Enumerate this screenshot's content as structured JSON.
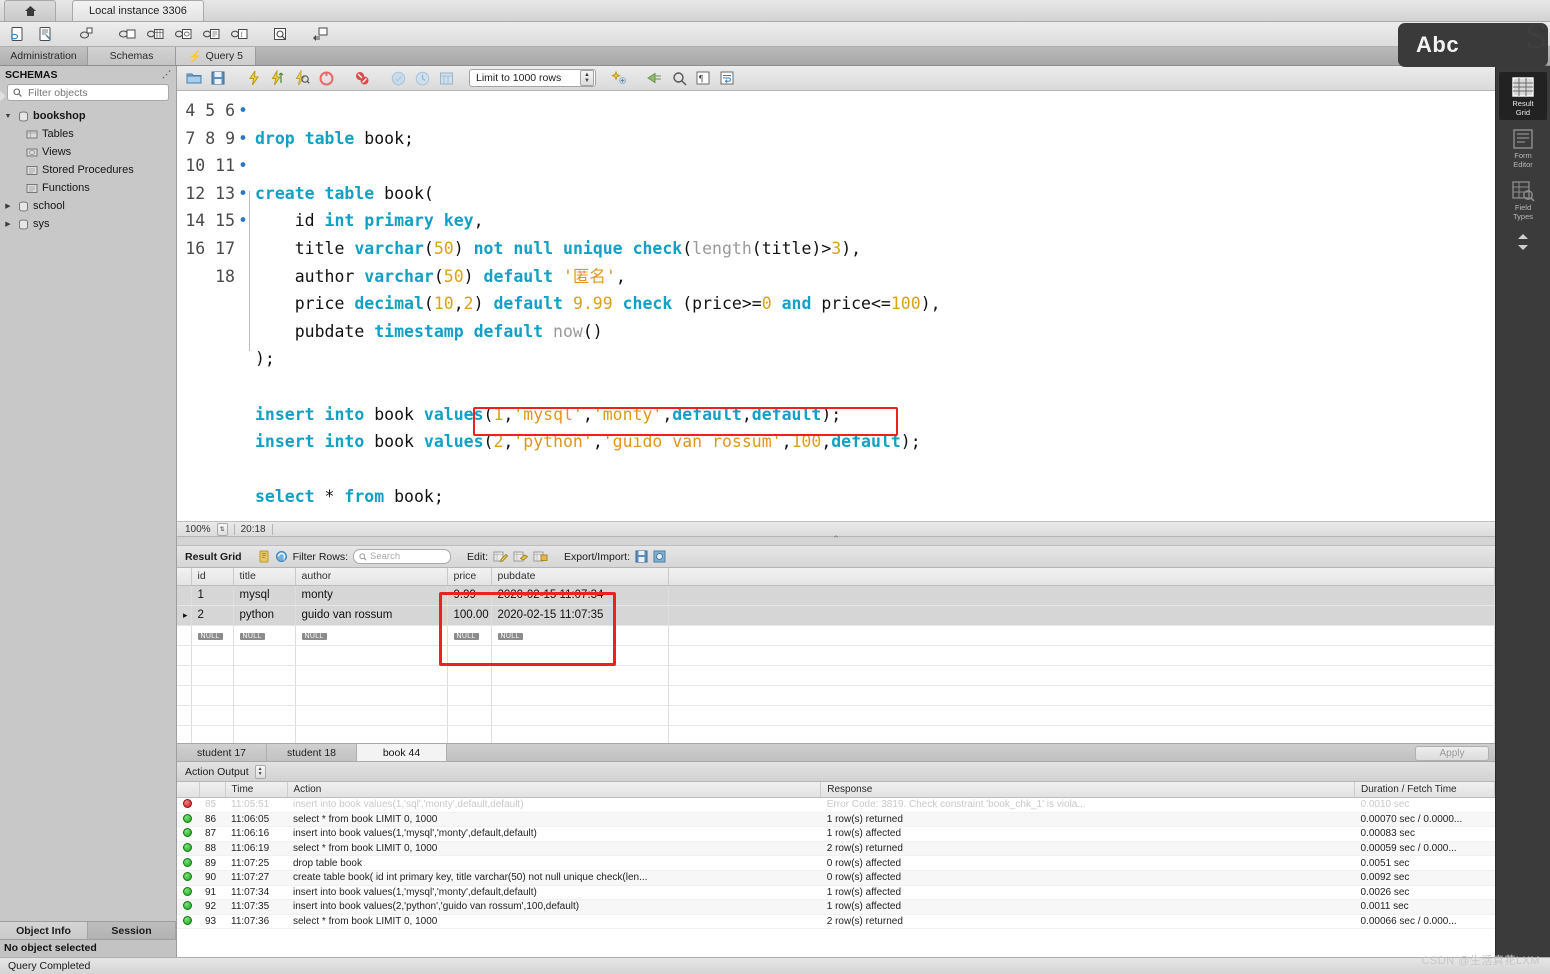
{
  "window": {
    "home_tab_icon": "home-icon",
    "instance_tab": "Local instance 3306"
  },
  "main_toolbar": {
    "buttons": [
      {
        "name": "new-sql-tab-icon",
        "tip": "New SQL Tab"
      },
      {
        "name": "open-sql-script-icon",
        "tip": "Open SQL Script"
      },
      {
        "name": "new-connection-icon",
        "tip": "New Connection"
      },
      {
        "name": "new-schema-icon",
        "tip": "Create New Schema"
      },
      {
        "name": "new-table-icon",
        "tip": "Create New Table"
      },
      {
        "name": "new-view-icon",
        "tip": "Create New View"
      },
      {
        "name": "new-procedure-icon",
        "tip": "Create New Procedure"
      },
      {
        "name": "new-function-icon",
        "tip": "Create New Function"
      },
      {
        "name": "search-table-data-icon",
        "tip": "Search Table Data"
      },
      {
        "name": "reconnect-dbms-icon",
        "tip": "Reconnect to DBMS"
      }
    ]
  },
  "nav_tabs": [
    {
      "label": "Administration",
      "active": false
    },
    {
      "label": "Schemas",
      "active": true
    },
    {
      "label": "Query 5",
      "active": true,
      "icon": "lightning-icon"
    }
  ],
  "sidebar": {
    "header": "SCHEMAS",
    "collapse_icon": "collapse-icon",
    "search_placeholder": "Filter objects",
    "search_value": "",
    "search_icon": "search-icon",
    "tree": [
      {
        "label": "bookshop",
        "level": 1,
        "expanded": true,
        "bold": true
      },
      {
        "label": "Tables",
        "level": 2
      },
      {
        "label": "Views",
        "level": 2
      },
      {
        "label": "Stored Procedures",
        "level": 2
      },
      {
        "label": "Functions",
        "level": 2
      },
      {
        "label": "school",
        "level": 1,
        "expanded": false
      },
      {
        "label": "sys",
        "level": 1,
        "expanded": false
      }
    ],
    "bottom_tabs": [
      {
        "label": "Object Info",
        "active": true
      },
      {
        "label": "Session",
        "active": false
      }
    ],
    "bottom_note": "No object selected"
  },
  "query_toolbar": {
    "buttons": [
      {
        "name": "open-script-icon"
      },
      {
        "name": "save-script-icon"
      },
      {
        "name": "execute-statement-icon"
      },
      {
        "name": "execute-current-statement-icon"
      },
      {
        "name": "explain-statement-icon"
      },
      {
        "name": "stop-execution-icon"
      },
      {
        "name": "toggle-stop-on-error-icon"
      },
      {
        "name": "commit-icon"
      },
      {
        "name": "rollback-icon"
      },
      {
        "name": "autocommit-icon"
      },
      {
        "name": "beautify-query-icon"
      },
      {
        "name": "find-icon"
      },
      {
        "name": "toggle-invisible-chars-icon"
      },
      {
        "name": "wrap-lines-icon"
      }
    ],
    "limit_label": "Limit to 1000 rows",
    "limit_dropdown_icon": "stepper-icon"
  },
  "editor": {
    "zoom": "100%",
    "cursor_pos": "20:18",
    "lines": [
      {
        "n": "4",
        "marker": "",
        "tokens": []
      },
      {
        "n": "5",
        "marker": "•",
        "tokens": [
          {
            "t": "drop",
            "c": "k"
          },
          {
            "t": " ",
            "c": "pl"
          },
          {
            "t": "table",
            "c": "k"
          },
          {
            "t": " book;",
            "c": "pl"
          }
        ]
      },
      {
        "n": "6",
        "marker": "",
        "tokens": []
      },
      {
        "n": "7",
        "marker": "•",
        "fold": true,
        "tokens": [
          {
            "t": "create",
            "c": "k"
          },
          {
            "t": " ",
            "c": "pl"
          },
          {
            "t": "table",
            "c": "k"
          },
          {
            "t": " book(",
            "c": "pl"
          }
        ]
      },
      {
        "n": "8",
        "marker": "",
        "tokens": [
          {
            "t": "    id ",
            "c": "pl"
          },
          {
            "t": "int",
            "c": "k"
          },
          {
            "t": " ",
            "c": "pl"
          },
          {
            "t": "primary",
            "c": "k"
          },
          {
            "t": " ",
            "c": "pl"
          },
          {
            "t": "key",
            "c": "k"
          },
          {
            "t": ",",
            "c": "pl"
          }
        ]
      },
      {
        "n": "9",
        "marker": "",
        "tokens": [
          {
            "t": "    title ",
            "c": "pl"
          },
          {
            "t": "varchar",
            "c": "k"
          },
          {
            "t": "(",
            "c": "pl"
          },
          {
            "t": "50",
            "c": "num"
          },
          {
            "t": ") ",
            "c": "pl"
          },
          {
            "t": "not",
            "c": "k"
          },
          {
            "t": " ",
            "c": "pl"
          },
          {
            "t": "null",
            "c": "k"
          },
          {
            "t": " ",
            "c": "pl"
          },
          {
            "t": "unique",
            "c": "k"
          },
          {
            "t": " ",
            "c": "pl"
          },
          {
            "t": "check",
            "c": "k"
          },
          {
            "t": "(",
            "c": "pl"
          },
          {
            "t": "length",
            "c": "fn"
          },
          {
            "t": "(title)>",
            "c": "pl"
          },
          {
            "t": "3",
            "c": "num"
          },
          {
            "t": "),",
            "c": "pl"
          }
        ]
      },
      {
        "n": "10",
        "marker": "",
        "tokens": [
          {
            "t": "    author ",
            "c": "pl"
          },
          {
            "t": "varchar",
            "c": "k"
          },
          {
            "t": "(",
            "c": "pl"
          },
          {
            "t": "50",
            "c": "num"
          },
          {
            "t": ") ",
            "c": "pl"
          },
          {
            "t": "default",
            "c": "k"
          },
          {
            "t": " ",
            "c": "pl"
          },
          {
            "t": "'匿名'",
            "c": "str"
          },
          {
            "t": ",",
            "c": "pl"
          }
        ]
      },
      {
        "n": "11",
        "marker": "",
        "tokens": [
          {
            "t": "    price ",
            "c": "pl"
          },
          {
            "t": "decimal",
            "c": "k"
          },
          {
            "t": "(",
            "c": "pl"
          },
          {
            "t": "10",
            "c": "num"
          },
          {
            "t": ",",
            "c": "pl"
          },
          {
            "t": "2",
            "c": "num"
          },
          {
            "t": ") ",
            "c": "pl"
          },
          {
            "t": "default",
            "c": "k"
          },
          {
            "t": " ",
            "c": "pl"
          },
          {
            "t": "9.99",
            "c": "num"
          },
          {
            "t": " ",
            "c": "pl"
          },
          {
            "t": "check",
            "c": "k"
          },
          {
            "t": " (price>=",
            "c": "pl"
          },
          {
            "t": "0",
            "c": "num"
          },
          {
            "t": " ",
            "c": "pl"
          },
          {
            "t": "and",
            "c": "k"
          },
          {
            "t": " price<=",
            "c": "pl"
          },
          {
            "t": "100",
            "c": "num"
          },
          {
            "t": "),",
            "c": "pl"
          }
        ]
      },
      {
        "n": "12",
        "marker": "",
        "tokens": [
          {
            "t": "    pubdate ",
            "c": "pl"
          },
          {
            "t": "timestamp",
            "c": "k"
          },
          {
            "t": " ",
            "c": "pl"
          },
          {
            "t": "default",
            "c": "k"
          },
          {
            "t": " ",
            "c": "pl"
          },
          {
            "t": "now",
            "c": "fn"
          },
          {
            "t": "()",
            "c": "pl"
          }
        ]
      },
      {
        "n": "13",
        "marker": "",
        "tokens": [
          {
            "t": ");",
            "c": "pl"
          }
        ]
      },
      {
        "n": "14",
        "marker": "",
        "tokens": []
      },
      {
        "n": "15",
        "marker": "•",
        "tokens": [
          {
            "t": "insert",
            "c": "k"
          },
          {
            "t": " ",
            "c": "pl"
          },
          {
            "t": "into",
            "c": "k"
          },
          {
            "t": " book ",
            "c": "pl"
          },
          {
            "t": "values",
            "c": "k"
          },
          {
            "t": "(",
            "c": "pl"
          },
          {
            "t": "1",
            "c": "num"
          },
          {
            "t": ",",
            "c": "pl"
          },
          {
            "t": "'mysql'",
            "c": "str"
          },
          {
            "t": ",",
            "c": "pl"
          },
          {
            "t": "'monty'",
            "c": "str"
          },
          {
            "t": ",",
            "c": "pl"
          },
          {
            "t": "default",
            "c": "k"
          },
          {
            "t": ",",
            "c": "pl"
          },
          {
            "t": "default",
            "c": "k"
          },
          {
            "t": ");",
            "c": "pl"
          }
        ]
      },
      {
        "n": "16",
        "marker": "•",
        "tokens": [
          {
            "t": "insert",
            "c": "k"
          },
          {
            "t": " ",
            "c": "pl"
          },
          {
            "t": "into",
            "c": "k"
          },
          {
            "t": " book ",
            "c": "pl"
          },
          {
            "t": "values",
            "c": "k"
          },
          {
            "t": "(",
            "c": "pl"
          },
          {
            "t": "2",
            "c": "num"
          },
          {
            "t": ",",
            "c": "pl"
          },
          {
            "t": "'python'",
            "c": "str"
          },
          {
            "t": ",",
            "c": "pl"
          },
          {
            "t": "'guido van rossum'",
            "c": "str"
          },
          {
            "t": ",",
            "c": "pl"
          },
          {
            "t": "100",
            "c": "num"
          },
          {
            "t": ",",
            "c": "pl"
          },
          {
            "t": "default",
            "c": "k"
          },
          {
            "t": ");",
            "c": "pl"
          }
        ]
      },
      {
        "n": "17",
        "marker": "",
        "tokens": []
      },
      {
        "n": "18",
        "marker": "•",
        "tokens": [
          {
            "t": "select",
            "c": "k"
          },
          {
            "t": " * ",
            "c": "pl"
          },
          {
            "t": "from",
            "c": "k"
          },
          {
            "t": " book;",
            "c": "pl"
          }
        ]
      }
    ],
    "run_button_icon": "play-triangle-icon",
    "highlight_color": "#ee2020"
  },
  "result_grid": {
    "title": "Result Grid",
    "filter_label": "Filter Rows:",
    "filter_placeholder": "Search",
    "filter_value": "",
    "edit_label": "Edit:",
    "export_label": "Export/Import:",
    "toolbar_icons": [
      {
        "name": "grid-note-icon"
      },
      {
        "name": "refresh-icon"
      },
      {
        "name": "edit-row-icon"
      },
      {
        "name": "insert-row-icon"
      },
      {
        "name": "delete-row-icon"
      },
      {
        "name": "export-recordset-icon"
      },
      {
        "name": "import-recordset-icon"
      }
    ],
    "columns": [
      "id",
      "title",
      "author",
      "price",
      "pubdate"
    ],
    "rows": [
      {
        "marker": "",
        "id": "1",
        "title": "mysql",
        "author": "monty",
        "price": "9.99",
        "pubdate": "2020-02-15 11:07:34"
      },
      {
        "marker": "▸",
        "id": "2",
        "title": "python",
        "author": "guido van rossum",
        "price": "100.00",
        "pubdate": "2020-02-15 11:07:35"
      },
      {
        "marker": "",
        "id": "NULL",
        "title": "NULL",
        "author": "NULL",
        "price": "NULL",
        "pubdate": "NULL"
      }
    ],
    "highlight_color": "#ee2020"
  },
  "right_panel": {
    "items": [
      {
        "label": "Result\nGrid",
        "name": "result-grid",
        "selected": true
      },
      {
        "label": "Form\nEditor",
        "name": "form-editor",
        "selected": false
      },
      {
        "label": "Field\nTypes",
        "name": "field-types",
        "selected": false
      }
    ],
    "more_icon": "chevron-updown-icon"
  },
  "result_tabs": {
    "tabs": [
      {
        "label": "student 17",
        "active": false
      },
      {
        "label": "student 18",
        "active": false
      },
      {
        "label": "book 44",
        "active": true
      }
    ],
    "apply_label": "Apply"
  },
  "action_output": {
    "title": "Action Output",
    "columns": [
      "",
      "Time",
      "Action",
      "Response",
      "Duration / Fetch Time"
    ],
    "rows": [
      {
        "status": "error",
        "n": "85",
        "time": "11:05:51",
        "action": "insert into book values(1,'sql','monty',default,default)",
        "response": "Error Code: 3819. Check constraint 'book_chk_1' is viola...",
        "duration": "0.0010 sec",
        "faded": true
      },
      {
        "status": "ok",
        "n": "86",
        "time": "11:06:05",
        "action": "select * from book LIMIT 0, 1000",
        "response": "1 row(s) returned",
        "duration": "0.00070 sec / 0.0000..."
      },
      {
        "status": "ok",
        "n": "87",
        "time": "11:06:16",
        "action": "insert into book values(1,'mysql','monty',default,default)",
        "response": "1 row(s) affected",
        "duration": "0.00083 sec"
      },
      {
        "status": "ok",
        "n": "88",
        "time": "11:06:19",
        "action": "select * from book LIMIT 0, 1000",
        "response": "2 row(s) returned",
        "duration": "0.00059 sec / 0.000..."
      },
      {
        "status": "ok",
        "n": "89",
        "time": "11:07:25",
        "action": "drop table book",
        "response": "0 row(s) affected",
        "duration": "0.0051 sec"
      },
      {
        "status": "ok",
        "n": "90",
        "time": "11:07:27",
        "action": "create table book(   id int primary key,    title varchar(50) not null unique check(len...",
        "response": "0 row(s) affected",
        "duration": "0.0092 sec"
      },
      {
        "status": "ok",
        "n": "91",
        "time": "11:07:34",
        "action": "insert into book values(1,'mysql','monty',default,default)",
        "response": "1 row(s) affected",
        "duration": "0.0026 sec"
      },
      {
        "status": "ok",
        "n": "92",
        "time": "11:07:35",
        "action": "insert into book values(2,'python','guido van rossum',100,default)",
        "response": "1 row(s) affected",
        "duration": "0.0011 sec"
      },
      {
        "status": "ok",
        "n": "93",
        "time": "11:07:36",
        "action": "select * from book LIMIT 0, 1000",
        "response": "2 row(s) returned",
        "duration": "0.00066 sec / 0.000..."
      }
    ]
  },
  "status_bar": {
    "text": "Query Completed"
  },
  "overlay": {
    "abc_label": "Abc",
    "logo": "S",
    "watermark": "CSDN @生活真花LXM"
  }
}
